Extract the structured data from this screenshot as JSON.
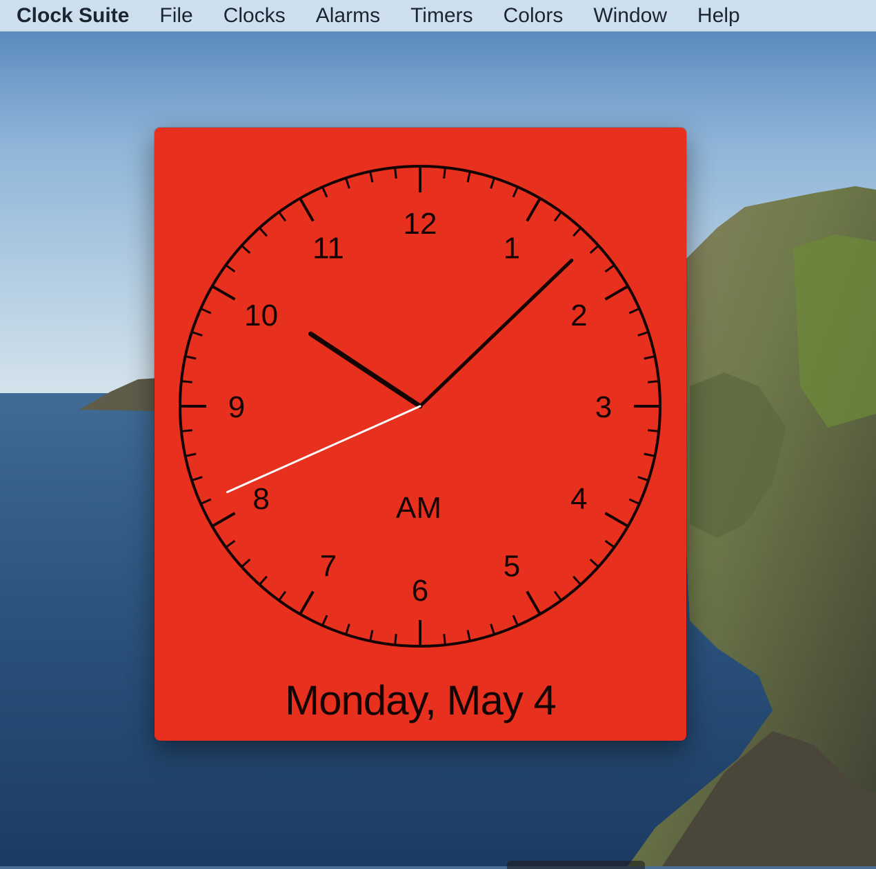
{
  "menubar": {
    "app_name": "Clock Suite",
    "items": [
      "File",
      "Clocks",
      "Alarms",
      "Timers",
      "Colors",
      "Window",
      "Help"
    ]
  },
  "clock": {
    "face_color": "#e8301f",
    "hand_color": "#150404",
    "second_hand_color": "#ffffff",
    "numerals": [
      "12",
      "1",
      "2",
      "3",
      "4",
      "5",
      "6",
      "7",
      "8",
      "9",
      "10",
      "11"
    ],
    "period": "AM",
    "time": {
      "hour": 10,
      "minute": 7,
      "second": 41
    },
    "date": "Monday, May 4"
  }
}
